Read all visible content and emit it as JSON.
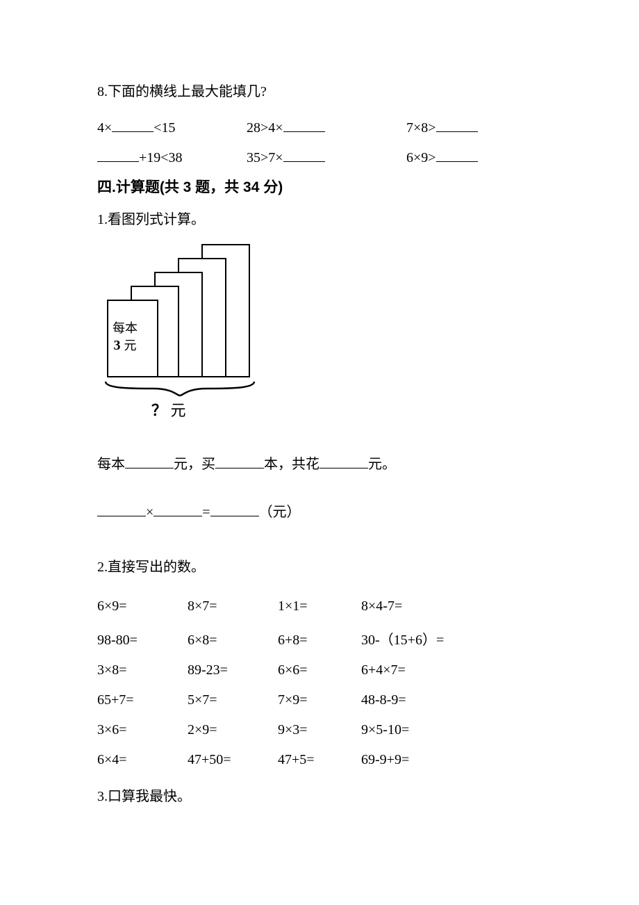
{
  "q8": {
    "prompt": "8.下面的横线上最大能填几?",
    "row1": {
      "c1a": "4×",
      "c1b": "<15",
      "c2a": "28>4×",
      "c3a": "7×8>"
    },
    "row2": {
      "c1b": "+19<38",
      "c2a": "35>7×",
      "c3a": "6×9>"
    }
  },
  "section4": {
    "heading": "四.计算题(共 3 题，共 34 分)"
  },
  "p1": {
    "title": "1.看图列式计算。",
    "book_label_l1": "每本",
    "book_label_num": "3",
    "book_label_unit": " 元",
    "brace_q": "？",
    "brace_unit": " 元",
    "fill_a": "每本",
    "fill_b": "元，买",
    "fill_c": "本，共花",
    "fill_d": "元。",
    "expr_mul": "×",
    "expr_eq": "=",
    "expr_unit": "（元）"
  },
  "p2": {
    "title": "2.直接写出的数。",
    "rows": [
      [
        "6×9=",
        "8×7=",
        "1×1=",
        "8×4-7="
      ],
      [
        "98-80=",
        "6×8=",
        "6+8=",
        "30-（15+6）="
      ],
      [
        "3×8=",
        "89-23=",
        "6×6=",
        "6+4×7="
      ],
      [
        "65+7=",
        "5×7=",
        "7×9=",
        "48-8-9="
      ],
      [
        "3×6=",
        "2×9=",
        "9×3=",
        "9×5-10="
      ],
      [
        "6×4=",
        "47+50=",
        "47+5=",
        "69-9+9="
      ]
    ]
  },
  "p3": {
    "title": "3.口算我最快。"
  }
}
